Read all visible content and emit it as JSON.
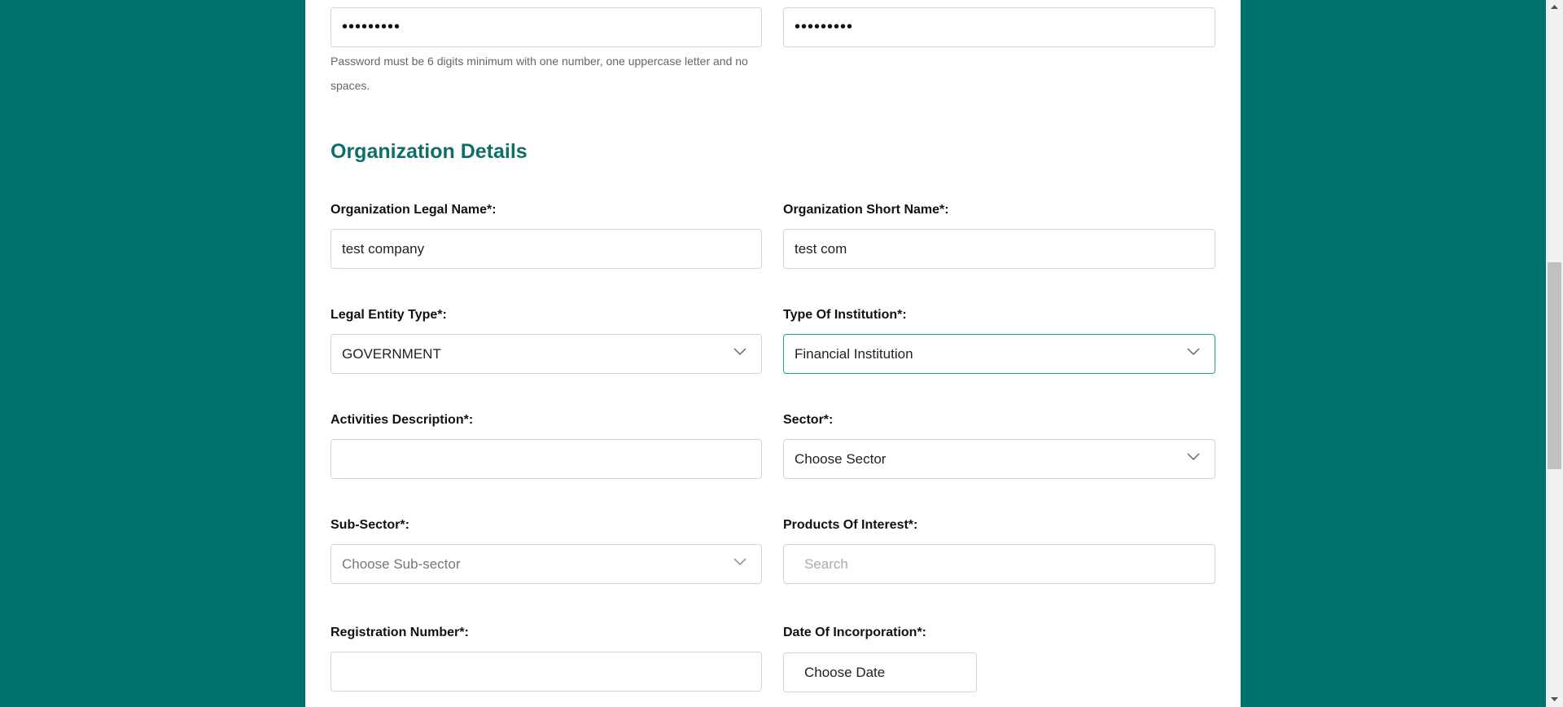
{
  "password": {
    "value": "•••••••••",
    "confirm_value": "•••••••••",
    "hint": "Password must be 6 digits minimum with one number, one uppercase letter and no spaces."
  },
  "section": {
    "title": "Organization Details"
  },
  "fields": {
    "legal_name": {
      "label": "Organization Legal Name*:",
      "value": "test company"
    },
    "short_name": {
      "label": "Organization Short Name*:",
      "value": "test com"
    },
    "entity_type": {
      "label": "Legal Entity Type*:",
      "value": "GOVERNMENT"
    },
    "institution_type": {
      "label": "Type Of Institution*:",
      "value": "Financial Institution"
    },
    "activities": {
      "label": "Activities Description*:",
      "value": ""
    },
    "sector": {
      "label": "Sector*:",
      "value": "Choose Sector"
    },
    "sub_sector": {
      "label": "Sub-Sector*:",
      "value": "Choose Sub-sector"
    },
    "products": {
      "label": "Products Of Interest*:",
      "placeholder": "Search"
    },
    "registration": {
      "label": "Registration Number*:",
      "value": ""
    },
    "incorporation": {
      "label": "Date Of Incorporation*:",
      "value": "Choose Date"
    }
  },
  "colors": {
    "background": "#00706a",
    "heading": "#0e6e6a",
    "focus_border": "#1aa58f"
  }
}
